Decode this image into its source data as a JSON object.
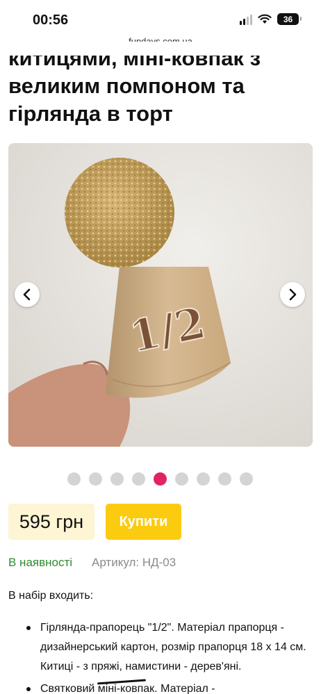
{
  "status_bar": {
    "time": "00:56",
    "battery": "36"
  },
  "url_bar": {
    "domain": "fundays.com.ua"
  },
  "product": {
    "title_lines": [
      "китицями, міні-ковпак з",
      "великим помпоном та",
      "гірлянда в торт"
    ],
    "image_badge_text": "1/2"
  },
  "gallery": {
    "prev_icon": "chevron-left-icon",
    "next_icon": "chevron-right-icon",
    "dot_count": 9,
    "active_dot": 5
  },
  "purchase": {
    "price": "595 грн",
    "buy_label": "Купити",
    "stock_status": "В наявності",
    "sku": "Артикул: НД-03"
  },
  "description": {
    "heading": "В набір входить:",
    "items": [
      "Гірлянда-прапорець \"1/2\". Матеріал прапорця - дизайнерський картон, розмір прапорця 18 х 14 см. Китиці - з пряжі, намистини - дерев'яні.",
      "Святковий міні-ковпак. Матеріал -"
    ]
  },
  "colors": {
    "accent_buy": "#fbcb10",
    "price_bg": "#fdf5d3",
    "stock_green": "#2f8a2f",
    "dot_active": "#e0245e",
    "dot_inactive": "#d4d4d4"
  }
}
